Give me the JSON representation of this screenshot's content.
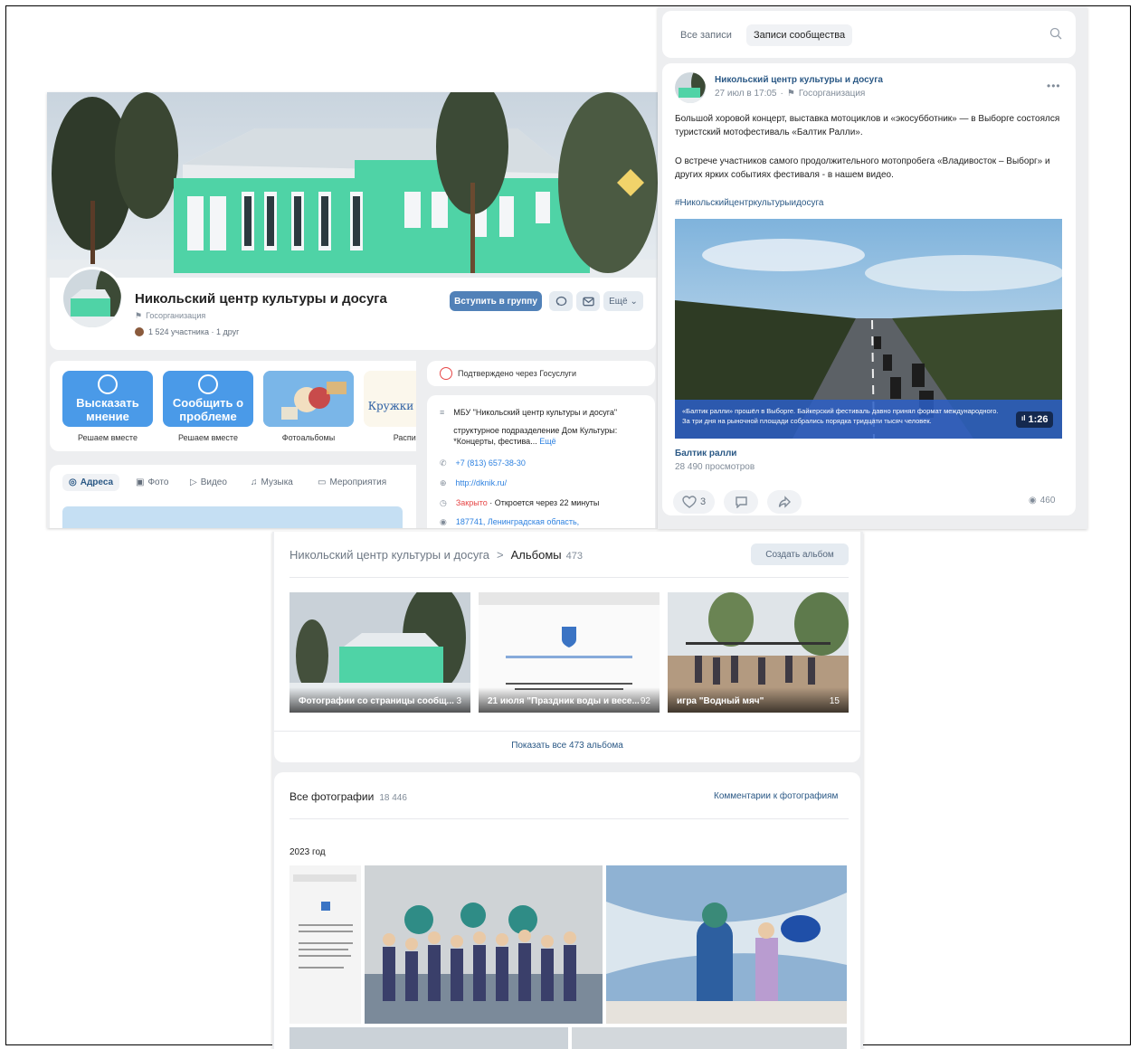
{
  "group": {
    "name": "Никольский центр культуры и досуга",
    "type": "Госорганизация",
    "members": "1 524 участника · 1 друг",
    "join_button": "Вступить в группу",
    "more_button": "Ещё"
  },
  "tiles": [
    {
      "label": "Высказать мнение",
      "caption": "Решаем вместе"
    },
    {
      "label": "Сообщить о проблеме",
      "caption": "Решаем вместе"
    },
    {
      "label": "",
      "caption": "Фотоальбомы"
    },
    {
      "label": "Кружки",
      "caption": "Расписа"
    }
  ],
  "tabs": [
    "Адреса",
    "Фото",
    "Видео",
    "Музыка",
    "Мероприятия"
  ],
  "info": {
    "verified": "Подтверждено через Госуслуги",
    "org_title": "МБУ \"Никольский центр культуры и досуга\"",
    "description": "структурное подразделение Дом Культуры: *Концерты, фестива...",
    "more": "Ещё",
    "phone": "+7 (813) 657-38-30",
    "site": "http://dknik.ru/",
    "status_closed": "Закрыто",
    "status_rest": " · Откроется через 22 минуты",
    "address": "187741, Ленинградская область,"
  },
  "wall": {
    "tab_all": "Все записи",
    "tab_community": "Записи сообщества",
    "author": "Никольский центр культуры и досуга",
    "date": "27 июл в 17:05",
    "author_type": "Госорганизация",
    "text1": "Большой хоровой концерт, выставка мотоциклов и «экосубботник» — в Выборге состоялся туристский мотофестиваль «Балтик Ралли».",
    "text2": "О встрече участников самого продолжительного мотопробега «Владивосток – Выборг» и других ярких событиях фестиваля - в нашем видео.",
    "hashtag": "#Никольскийцентркультурыидосуга",
    "video_caption": "«Балтик ралли» прошёл в Выборге. Байкерский фестиваль давно принял формат международного. За три дня на рыночной площади собрались порядка тридцати тысяч человек.",
    "video_duration": "1:26",
    "video_title": "Балтик ралли",
    "video_views": "28 490 просмотров",
    "likes": "3",
    "views": "460"
  },
  "albums": {
    "breadcrumb_group": "Никольский центр культуры и досуга",
    "breadcrumb_sep": ">",
    "title": "Альбомы",
    "count": "473",
    "create_button": "Создать альбом",
    "items": [
      {
        "title": "Фотографии со страницы сообщ...",
        "count": "3"
      },
      {
        "title": "21 июля \"Праздник воды и весе...",
        "count": "92"
      },
      {
        "title": "игра \"Водный мяч\"",
        "count": "15"
      }
    ],
    "show_all": "Показать все 473 альбома"
  },
  "photos": {
    "title": "Все фотографии",
    "count": "18 446",
    "comments_link": "Комментарии к фотографиям",
    "year": "2023 год"
  },
  "colors": {
    "accent": "#5181b8",
    "tile": "#4a9ae8",
    "building": "#4fd3a6",
    "closed": "#e64646"
  }
}
